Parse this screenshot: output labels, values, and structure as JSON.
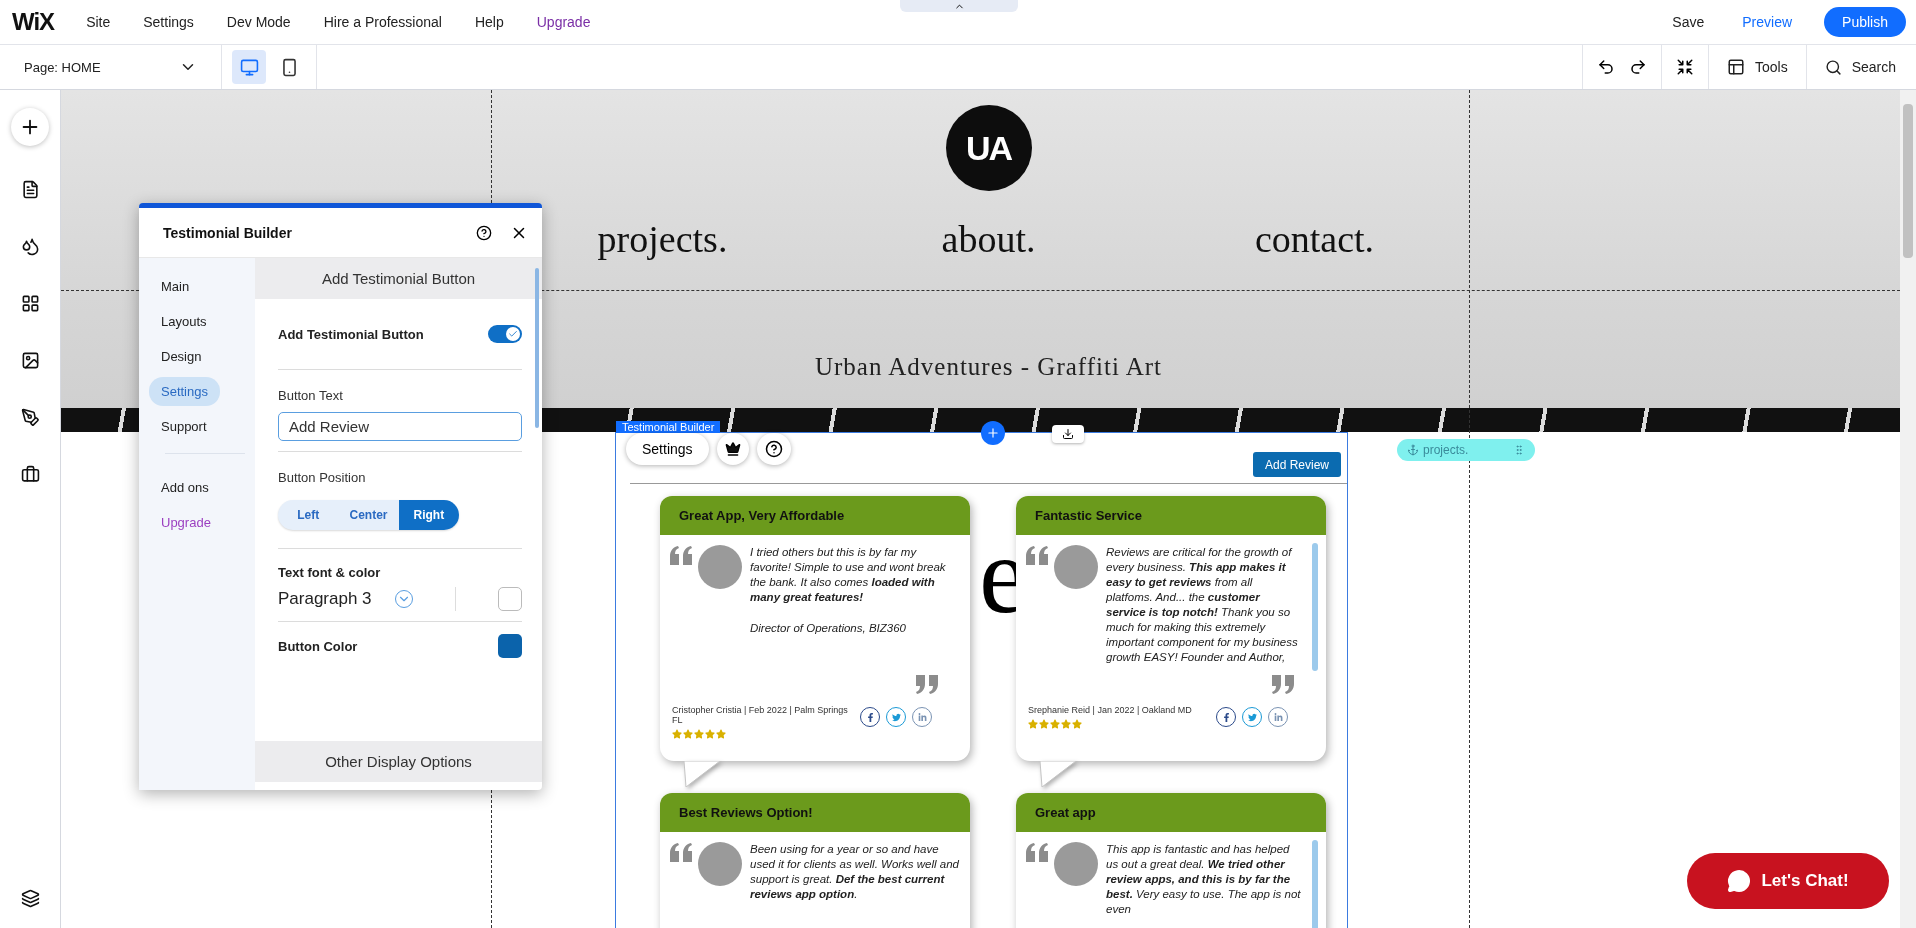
{
  "topbar": {
    "logo": "WiX",
    "menu": [
      {
        "label": "Site",
        "kind": "normal"
      },
      {
        "label": "Settings",
        "kind": "normal"
      },
      {
        "label": "Dev Mode",
        "kind": "normal"
      },
      {
        "label": "Hire a Professional",
        "kind": "normal"
      },
      {
        "label": "Help",
        "kind": "normal"
      },
      {
        "label": "Upgrade",
        "kind": "upgrade"
      }
    ],
    "save": "Save",
    "preview": "Preview",
    "publish": "Publish"
  },
  "toolbar": {
    "page_selector": "Page: HOME",
    "view_modes": [
      {
        "kind": "desktop",
        "selected": true
      },
      {
        "kind": "mobile",
        "selected": false
      }
    ],
    "tools": "Tools",
    "search": "Search"
  },
  "site": {
    "logo": "UA",
    "nav": [
      "projects.",
      "about.",
      "contact."
    ],
    "tagline": "Urban Adventures - Graffiti Art",
    "background_letter": "e"
  },
  "anchor": {
    "label": "projects."
  },
  "widget": {
    "tag": "Testimonial Builder",
    "settings": "Settings",
    "add_button": "Add Review",
    "cards": [
      {
        "title": "Great App, Very Affordable",
        "quote": "I tried others but this is by far my favorite! Simple to use and wont break the bank. It also comes **loaded with many great features!**",
        "role": "Director of Operations, BIZ360",
        "author": "Cristopher Cristia | Feb 2022 | Palm Springs FL",
        "stars": 5,
        "scrollable": false
      },
      {
        "title": "Fantastic Service",
        "quote": "Reviews are critical for the growth of every business. **This app makes it easy to get reviews** from all platfoms. And... the **customer service is top notch!** Thank you so much for making this extremely important component for my business growth EASY! Founder and Author,",
        "author": "Srephanie Reid | Jan 2022 | Oakland MD",
        "stars": 5,
        "scrollable": true
      },
      {
        "title": "Best Reviews Option!",
        "quote": "Been using for a year or so and have used it for clients as well. Works well and support is great. **Def the best current reviews app option**.",
        "scrollable": false
      },
      {
        "title": "Great app",
        "quote": "This app is fantastic and has helped us out a great deal. **We tried other review apps, and this is by far the best.** Very easy to use. The app is not even",
        "scrollable": true
      }
    ]
  },
  "panel": {
    "title": "Testimonial Builder",
    "nav": [
      {
        "label": "Main",
        "selected": false,
        "kind": "main"
      },
      {
        "label": "Layouts",
        "selected": false,
        "kind": "main"
      },
      {
        "label": "Design",
        "selected": false,
        "kind": "main"
      },
      {
        "label": "Settings",
        "selected": true,
        "kind": "main"
      },
      {
        "label": "Support",
        "selected": false,
        "kind": "main"
      },
      {
        "label": "Add ons",
        "selected": false,
        "kind": "extra"
      },
      {
        "label": "Upgrade",
        "selected": false,
        "kind": "upgrade"
      }
    ],
    "section": "Add Testimonial Button",
    "toggle": {
      "label": "Add Testimonial Button",
      "on": true
    },
    "button_text": {
      "label": "Button Text",
      "value": "Add Review"
    },
    "position": {
      "label": "Button Position",
      "options": [
        {
          "label": "Left",
          "selected": false
        },
        {
          "label": "Center",
          "selected": false
        },
        {
          "label": "Right",
          "selected": true
        }
      ]
    },
    "font": {
      "label": "Text font & color",
      "value": "Paragraph 3",
      "color": "#ffffff"
    },
    "button_color": {
      "label": "Button Color",
      "color": "#0b63ab"
    },
    "footer": "Other Display Options"
  },
  "chat": {
    "label": "Let's Chat!"
  }
}
